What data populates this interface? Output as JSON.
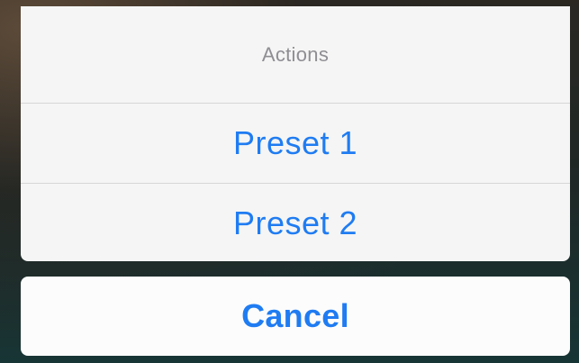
{
  "action_sheet": {
    "title": "Actions",
    "options": [
      {
        "label": "Preset 1"
      },
      {
        "label": "Preset 2"
      }
    ],
    "cancel_label": "Cancel"
  },
  "colors": {
    "accent": "#1F7CF2",
    "title_text": "#8E8E93",
    "sheet_background": "#F5F5F5",
    "separator": "#D6D6D6"
  }
}
